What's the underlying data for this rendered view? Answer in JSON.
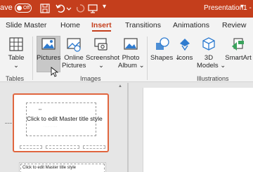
{
  "titlebar": {
    "save_label": "ave",
    "autosave_state": "Off",
    "document_title": "Presentation1 -",
    "accent_color": "#c43e1c"
  },
  "tabs": [
    {
      "label": "Slide Master"
    },
    {
      "label": "Home"
    },
    {
      "label": "Insert"
    },
    {
      "label": "Transitions"
    },
    {
      "label": "Animations"
    },
    {
      "label": "Review"
    }
  ],
  "ribbon": {
    "table": {
      "label": "Table"
    },
    "pictures": {
      "label": "Pictures"
    },
    "online_pictures": {
      "label1": "Online",
      "label2": "Pictures"
    },
    "screenshot": {
      "label": "Screenshot"
    },
    "photo_album": {
      "label1": "Photo",
      "label2": "Album"
    },
    "shapes": {
      "label": "Shapes"
    },
    "icons": {
      "label": "Icons"
    },
    "models_3d": {
      "label1": "3D",
      "label2": "Models"
    },
    "smartart": {
      "label": "SmartArt"
    },
    "groups": {
      "tables": "Tables",
      "images": "Images",
      "illustrations": "Illustrations"
    }
  },
  "slides": {
    "master_title": "Click to edit Master title style",
    "layout_title": "Click to edit Master title style"
  }
}
